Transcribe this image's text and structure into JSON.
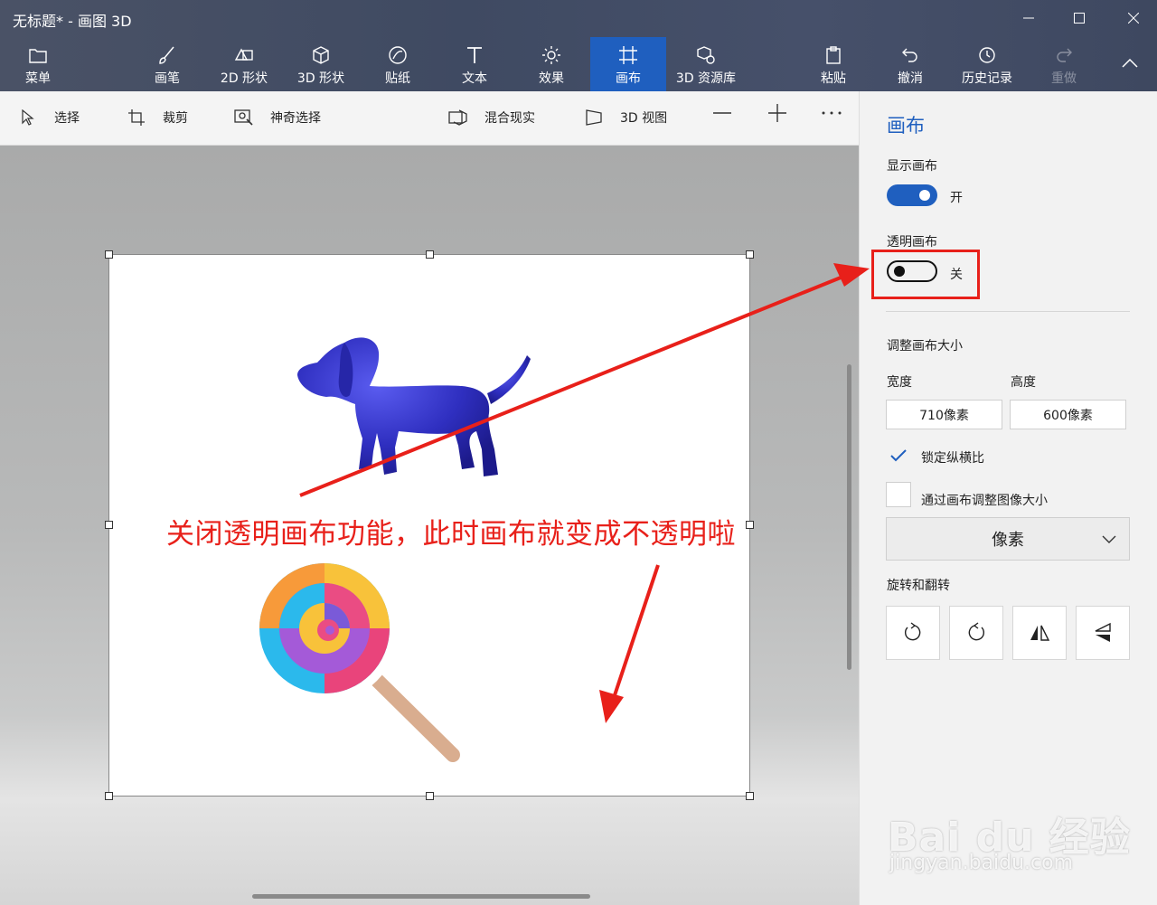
{
  "window": {
    "title": "无标题* - 画图 3D"
  },
  "toolbar": {
    "menu": "菜单",
    "tools": [
      "画笔",
      "2D 形状",
      "3D 形状",
      "贴纸",
      "文本",
      "效果",
      "画布",
      "3D 资源库"
    ],
    "paste": "粘贴",
    "undo": "撤消",
    "history": "历史记录",
    "redo": "重做"
  },
  "subtoolbar": {
    "select": "选择",
    "crop": "裁剪",
    "magic_select": "神奇选择",
    "mixed_reality": "混合现实",
    "view_3d": "3D 视图"
  },
  "annotation": "关闭透明画布功能，此时画布就变成不透明啦",
  "panel": {
    "title": "画布",
    "show_canvas": {
      "label": "显示画布",
      "state": "开",
      "on": true
    },
    "transparent_canvas": {
      "label": "透明画布",
      "state": "关",
      "on": false
    },
    "resize": {
      "heading": "调整画布大小",
      "width_label": "宽度",
      "height_label": "高度",
      "width_value": "710像素",
      "height_value": "600像素",
      "lock_aspect": "锁定纵横比",
      "lock_aspect_checked": true,
      "resize_image": "通过画布调整图像大小",
      "resize_image_checked": false,
      "unit": "像素"
    },
    "rotate_heading": "旋转和翻转"
  },
  "watermark": {
    "main": "Bai du 经验",
    "sub": "jingyan.baidu.com"
  },
  "colors": {
    "accent": "#1f5fbf",
    "annotation": "#e8201a",
    "topbar": "#434c63"
  }
}
